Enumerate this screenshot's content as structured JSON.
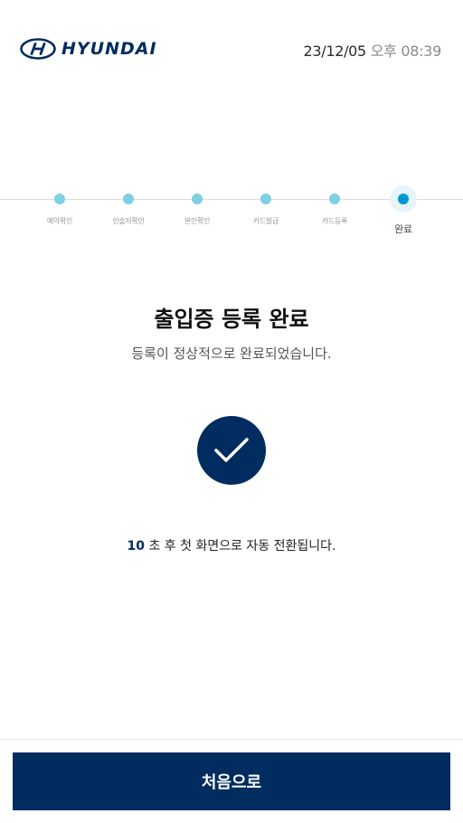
{
  "header": {
    "brand": "HYUNDAI",
    "date": "23/12/05",
    "ampm": "오후",
    "time": "08:39"
  },
  "stepper": {
    "steps": [
      {
        "label": "예약확인",
        "active": false
      },
      {
        "label": "인솔자확인",
        "active": false
      },
      {
        "label": "본인확인",
        "active": false
      },
      {
        "label": "카드발급",
        "active": false
      },
      {
        "label": "카드등록",
        "active": false
      },
      {
        "label": "완료",
        "active": true
      }
    ]
  },
  "content": {
    "title": "출입증 등록 완료",
    "subtitle": "등록이 정상적으로 완료되었습니다.",
    "check_icon": "check-icon",
    "countdown_seconds": "10",
    "countdown_text": " 초 후 첫 화면으로 자동 전환됩니다."
  },
  "footer": {
    "home_button_label": "처음으로"
  },
  "colors": {
    "brand_navy": "#002c5f",
    "step_dot": "#7ed0e2",
    "step_dot_active": "#009ad2"
  }
}
